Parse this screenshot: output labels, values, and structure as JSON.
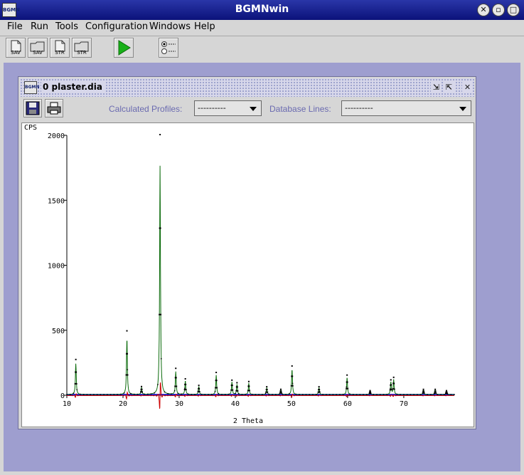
{
  "window": {
    "title": "BGMNwin",
    "app_icon_text": "BGMN"
  },
  "menu": [
    {
      "label": "File"
    },
    {
      "label": "Run"
    },
    {
      "label": "Tools"
    },
    {
      "label": "Configuration"
    },
    {
      "label": "Windows"
    },
    {
      "label": "Help"
    }
  ],
  "toolbar": {
    "buttons": [
      {
        "caption": "SAV"
      },
      {
        "caption": "SAV"
      },
      {
        "caption": "STR"
      },
      {
        "caption": "STR"
      }
    ]
  },
  "inner": {
    "title": "0 plaster.dia",
    "calc_label": "Calculated Profiles:",
    "calc_value": "----------",
    "db_label": "Database Lines:",
    "db_value": "----------"
  },
  "colors": {
    "measured": "#000000",
    "calculated": "#0b6b0b",
    "difference": "#cc0000",
    "background": "#1a1ad0"
  },
  "chart_data": {
    "type": "line",
    "ylabel": "CPS",
    "xlabel": "2 Theta",
    "x_ticks": [
      10,
      20,
      30,
      40,
      50,
      60,
      70
    ],
    "y_ticks": [
      0,
      500,
      1000,
      1500,
      2000
    ],
    "xlim": [
      10,
      79
    ],
    "ylim": [
      0,
      2000
    ],
    "background_level": 5,
    "peaks": [
      {
        "x": 11.6,
        "y": 270
      },
      {
        "x": 20.7,
        "y": 490
      },
      {
        "x": 23.3,
        "y": 60
      },
      {
        "x": 26.6,
        "y": 2000
      },
      {
        "x": 29.4,
        "y": 200
      },
      {
        "x": 31.1,
        "y": 120
      },
      {
        "x": 33.5,
        "y": 70
      },
      {
        "x": 36.6,
        "y": 170
      },
      {
        "x": 39.4,
        "y": 110
      },
      {
        "x": 40.3,
        "y": 90
      },
      {
        "x": 42.4,
        "y": 100
      },
      {
        "x": 45.6,
        "y": 60
      },
      {
        "x": 48.1,
        "y": 40
      },
      {
        "x": 50.1,
        "y": 220
      },
      {
        "x": 54.9,
        "y": 60
      },
      {
        "x": 59.9,
        "y": 150
      },
      {
        "x": 64.0,
        "y": 30
      },
      {
        "x": 67.7,
        "y": 110
      },
      {
        "x": 68.2,
        "y": 130
      },
      {
        "x": 73.5,
        "y": 40
      },
      {
        "x": 75.6,
        "y": 40
      },
      {
        "x": 77.6,
        "y": 30
      }
    ],
    "series": [
      {
        "name": "measured"
      },
      {
        "name": "calculated"
      },
      {
        "name": "difference"
      },
      {
        "name": "background"
      }
    ]
  }
}
